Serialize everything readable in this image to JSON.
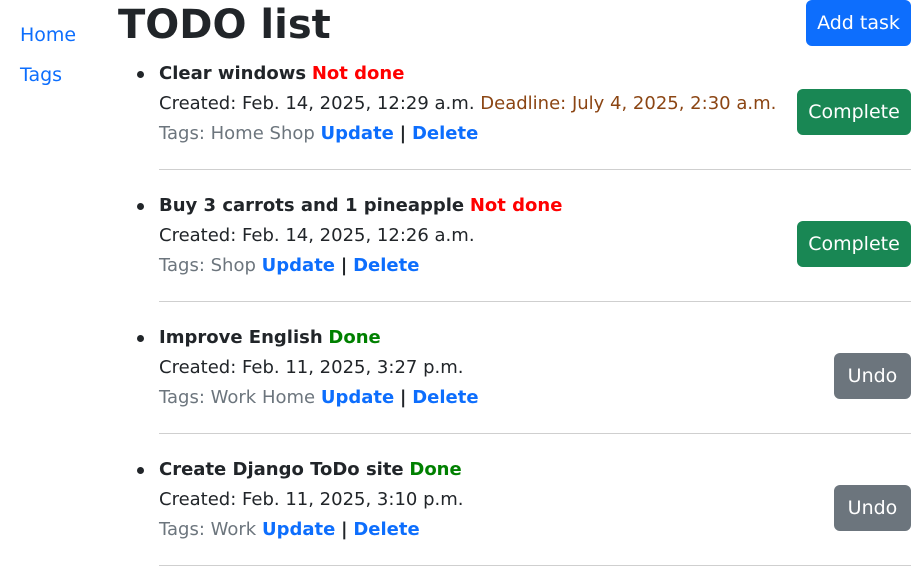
{
  "sidebar": {
    "items": [
      {
        "label": "Home"
      },
      {
        "label": "Tags"
      }
    ]
  },
  "header": {
    "title": "TODO list",
    "add_task_label": "Add task"
  },
  "tasks": [
    {
      "title": "Clear windows",
      "status": "Not done",
      "created": "Created: Feb. 14, 2025, 12:29 a.m.",
      "deadline": "Deadline: July 4, 2025, 2:30 a.m.",
      "tags": "Tags: Home Shop",
      "update_label": "Update",
      "separator": "|",
      "delete_label": "Delete",
      "action_label": "Complete"
    },
    {
      "title": "Buy 3 carrots and 1 pineapple",
      "status": "Not done",
      "created": "Created: Feb. 14, 2025, 12:26 a.m.",
      "tags": "Tags: Shop",
      "update_label": "Update",
      "separator": "|",
      "delete_label": "Delete",
      "action_label": "Complete"
    },
    {
      "title": "Improve English",
      "status": "Done",
      "created": "Created: Feb. 11, 2025, 3:27 p.m.",
      "tags": "Tags: Work Home",
      "update_label": "Update",
      "separator": "|",
      "delete_label": "Delete",
      "action_label": "Undo"
    },
    {
      "title": "Create Django ToDo site",
      "status": "Done",
      "created": "Created: Feb. 11, 2025, 3:10 p.m.",
      "tags": "Tags: Work",
      "update_label": "Update",
      "separator": "|",
      "delete_label": "Delete",
      "action_label": "Undo"
    }
  ],
  "colors": {
    "primary": "#0d6efd",
    "success": "#198754",
    "secondary": "#6c757d",
    "not_done": "#ff0000",
    "done": "#008000",
    "deadline": "#8b4513"
  }
}
